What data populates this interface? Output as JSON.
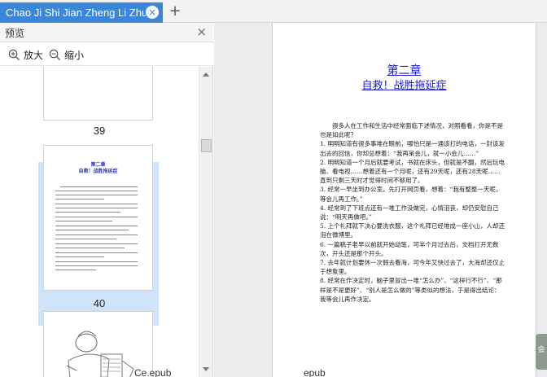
{
  "tab": {
    "title": "Chao Ji Shi Jian Zheng Li Zhu",
    "close": "×",
    "add": "+"
  },
  "panel": {
    "title": "预览",
    "close": "×",
    "zoom_in": "放大",
    "zoom_out": "缩小",
    "pages": [
      {
        "number": "39"
      },
      {
        "number": "40",
        "title": "第二章",
        "subtitle": "自救！战胜拖延症"
      }
    ]
  },
  "document": {
    "chapter": "第二章",
    "title": "自救！战胜拖延症",
    "paragraphs": [
      "很多人在工作和生活中经常面临下述情况，对照看看，你是不是也是如此呢？",
      "1. 明明知道有很多事堆在眼前，哪怕只是一通该打的电话，一封该发出去的回信，你却总想着：“我再呆会儿，就一小会儿……”",
      "2. 明明知道一个月后就要考试，书就在床头，但就是不翻，然后玩电脑、看电视……想着还有一个月呢，还有29天呢，还有28天呢……直到只剩三天时才觉得时间不够用了。",
      "3. 经常一早坐到办公室，先打开网页看，想着：“我有整整一天呢，等会儿再工作。”",
      "4. 经常到了下班点还有一堆工作没做完，心情沮丧，却仍安慰自己说：“明天再做吧。”",
      "5. 上个礼拜就下决心要洗衣服，这个礼拜已经堆成一座小山，人却还泡在微博里。",
      "6. 一篇稿子老早以前就开始动笔，可半个月过去后，文档打开无数次，开头还是那个开头。",
      "7. 去年就计划要休一次假去看海，可今年又快过去了，大海却还仅止于想象里。",
      "8. 经常在作决定时，脑子里冒出一堆“怎么办”、“这样行不行”、“那样是不是更好”、“别人是怎么做的”等类似的想法，于是得出结论：我等会儿再作决定。"
    ]
  },
  "bottom_labels": [
    "Ce.epub",
    "epub"
  ],
  "side_widget": "会",
  "colors": {
    "tab_active": "#3c86d9",
    "heading_blue": "#1a1ad0",
    "thumb_selected": "#cfe3fa"
  }
}
